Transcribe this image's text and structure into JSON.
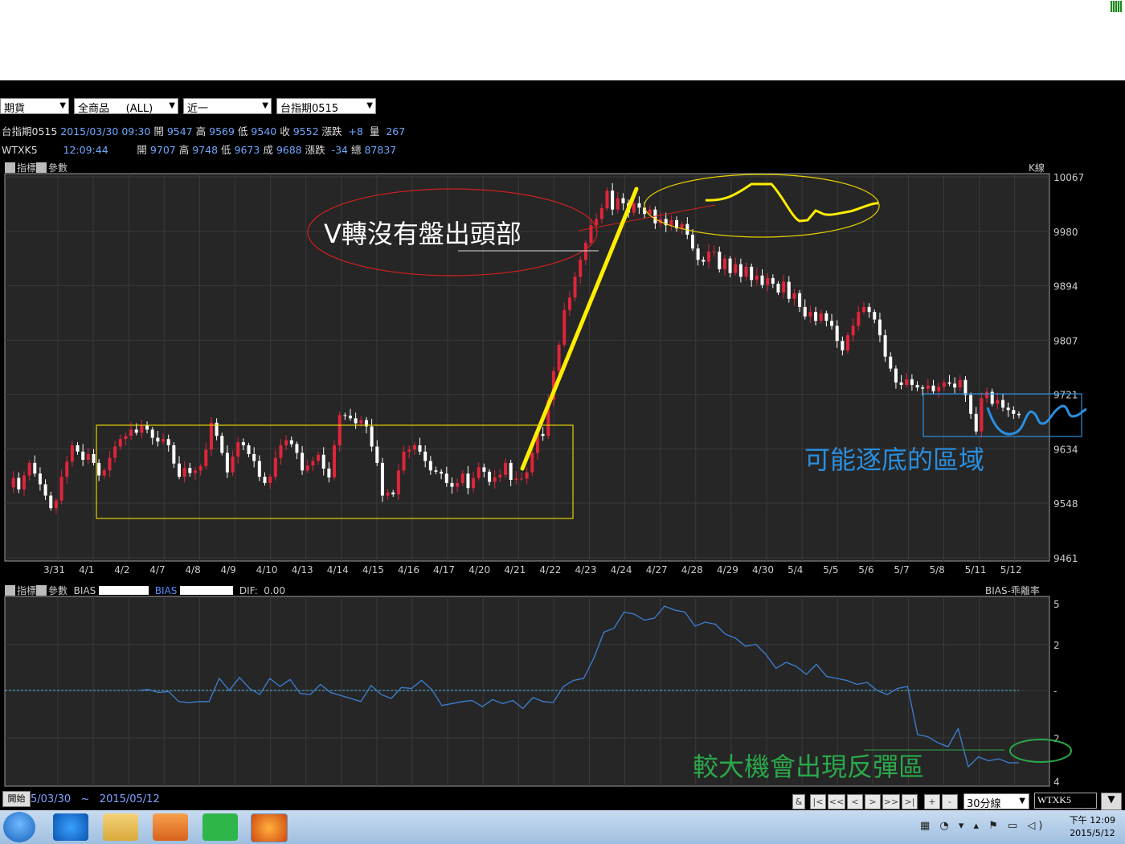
{
  "toolbar": {
    "market": "期貨",
    "product": "全商品     (ALL)",
    "period": "近一",
    "contract": "台指期0515"
  },
  "quote1": {
    "name": "台指期0515",
    "datetime": "2015/03/30 09:30",
    "open_lbl": "開",
    "open": "9547",
    "high_lbl": "高",
    "high": "9569",
    "low_lbl": "低",
    "low": "9540",
    "close_lbl": "收",
    "close": "9552",
    "chg_lbl": "漲跌",
    "chg": "+8",
    "vol_lbl": "量",
    "vol": "267"
  },
  "quote2": {
    "name": "WTXK5",
    "time": "12:09:44",
    "open_lbl": "開",
    "open": "9707",
    "high_lbl": "高",
    "high": "9748",
    "low_lbl": "低",
    "low": "9673",
    "close_lbl": "成",
    "close": "9688",
    "chg_lbl": "漲跌",
    "chg": "-34",
    "vol_lbl": "總",
    "vol": "87837"
  },
  "main_panel": {
    "tab_indicator": "指標",
    "tab_param": "參數",
    "corner_label": "K線"
  },
  "sub_panel": {
    "tab_indicator": "指標",
    "tab_param": "參數",
    "bias1_label": "BIAS",
    "bias2_label": "BIAS",
    "dif_label": "DIF:",
    "dif_value": "0.00",
    "corner_label": "BIAS-乖離率"
  },
  "annotations": {
    "v_turn": "V轉沒有盤出頭部",
    "bottom_area": "可能逐底的區域",
    "rebound": "較大機會出現反彈區"
  },
  "colors": {
    "up": "#e0253a",
    "down": "#ffffff",
    "bias_line": "#3e7fd4",
    "grid": "#3a3a3a",
    "annot_red": "#d12020",
    "annot_yellow": "#ffee00",
    "annot_blue": "#2a8fe0",
    "annot_green": "#2aa84a"
  },
  "chart_data": [
    {
      "type": "candlestick",
      "categories": [
        "3/31",
        "4/1",
        "4/2",
        "4/7",
        "4/8",
        "4/9",
        "4/10",
        "4/13",
        "4/14",
        "4/15",
        "4/16",
        "4/17",
        "4/20",
        "4/21",
        "4/22",
        "4/23",
        "4/24",
        "4/27",
        "4/28",
        "4/29",
        "4/30",
        "5/4",
        "5/5",
        "5/6",
        "5/7",
        "5/8",
        "5/11",
        "5/12"
      ],
      "y_ticks": [
        "10067",
        "9980",
        "9894",
        "9807",
        "9721",
        "9634",
        "9548",
        "9461"
      ],
      "ylim": [
        9461,
        10067
      ],
      "close_path": [
        9573,
        9588,
        9570,
        9592,
        9612,
        9595,
        9578,
        9560,
        9540,
        9552,
        9590,
        9614,
        9640,
        9630,
        9617,
        9626,
        9612,
        9592,
        9600,
        9620,
        9638,
        9650,
        9655,
        9665,
        9660,
        9672,
        9665,
        9652,
        9646,
        9650,
        9640,
        9611,
        9590,
        9604,
        9596,
        9600,
        9607,
        9633,
        9676,
        9655,
        9628,
        9597,
        9622,
        9645,
        9640,
        9626,
        9615,
        9590,
        9580,
        9590,
        9620,
        9640,
        9648,
        9642,
        9628,
        9600,
        9608,
        9615,
        9625,
        9603,
        9589,
        9640,
        9688,
        9687,
        9683,
        9675,
        9680,
        9670,
        9638,
        9612,
        9560,
        9565,
        9562,
        9600,
        9630,
        9633,
        9640,
        9630,
        9615,
        9600,
        9598,
        9595,
        9580,
        9574,
        9580,
        9595,
        9572,
        9588,
        9605,
        9598,
        9582,
        9589,
        9593,
        9612,
        9585,
        9587,
        9587,
        9597,
        9628,
        9658,
        9655,
        9712,
        9758,
        9800,
        9855,
        9875,
        9908,
        9935,
        9962,
        9990,
        10000,
        10017,
        10045,
        10015,
        10033,
        10025,
        10010,
        10025,
        10018,
        10008,
        10015,
        9993,
        10000,
        9990,
        9998,
        9985,
        9992,
        9975,
        9953,
        9935,
        9932,
        9948,
        9948,
        9920,
        9937,
        9914,
        9928,
        9908,
        9924,
        9903,
        9910,
        9895,
        9906,
        9897,
        9883,
        9900,
        9873,
        9882,
        9860,
        9845,
        9852,
        9838,
        9850,
        9838,
        9830,
        9806,
        9791,
        9815,
        9830,
        9852,
        9860,
        9852,
        9840,
        9815,
        9781,
        9762,
        9740,
        9736,
        9745,
        9736,
        9732,
        9730,
        9735,
        9726,
        9733,
        9740,
        9738,
        9732,
        9744,
        9720,
        9690,
        9662,
        9715,
        9725,
        9706,
        9712,
        9700,
        9696,
        9690,
        9688
      ]
    },
    {
      "type": "line",
      "series": [
        {
          "name": "BIAS",
          "values": [
            0.0,
            0.05,
            -0.1,
            -0.05,
            -0.55,
            -0.6,
            -0.55,
            -0.55,
            0.6,
            0.0,
            0.65,
            0.1,
            -0.2,
            0.6,
            0.2,
            0.55,
            -0.15,
            -0.2,
            0.3,
            -0.1,
            -0.25,
            -0.4,
            -0.55,
            0.25,
            -0.2,
            -0.4,
            0.15,
            0.1,
            0.5,
            0.05,
            -0.75,
            -0.65,
            -0.55,
            -0.5,
            -0.8,
            -0.45,
            -0.65,
            -0.5,
            -0.9,
            -0.35,
            -0.55,
            -0.6,
            0.2,
            0.5,
            0.6,
            1.6,
            2.9,
            3.1,
            3.9,
            3.8,
            3.5,
            3.6,
            4.2,
            4.0,
            3.9,
            3.2,
            3.4,
            3.3,
            2.8,
            2.6,
            2.2,
            2.3,
            1.8,
            1.1,
            1.4,
            1.2,
            0.8,
            1.3,
            0.7,
            0.6,
            0.5,
            0.3,
            0.4,
            0.0,
            -0.2,
            0.1,
            0.2,
            -2.2,
            -2.3,
            -2.6,
            -2.8,
            -1.9,
            -3.8,
            -3.3,
            -3.5,
            -3.4,
            -3.6,
            -3.6
          ]
        }
      ],
      "y_ticks": [
        "5",
        "2",
        "-",
        "2",
        "4"
      ]
    }
  ],
  "status": {
    "start_label": "開始",
    "date_range": "5/03/30   ~   2015/05/12"
  },
  "nav": {
    "buttons": [
      "&",
      "|<",
      "<<",
      "<",
      ">",
      ">>",
      ">|",
      "+",
      "-"
    ],
    "timeframe": "30分線",
    "symbol": "WTXK5"
  },
  "taskbar": {
    "time": "下午 12:09",
    "date": "2015/5/12"
  }
}
